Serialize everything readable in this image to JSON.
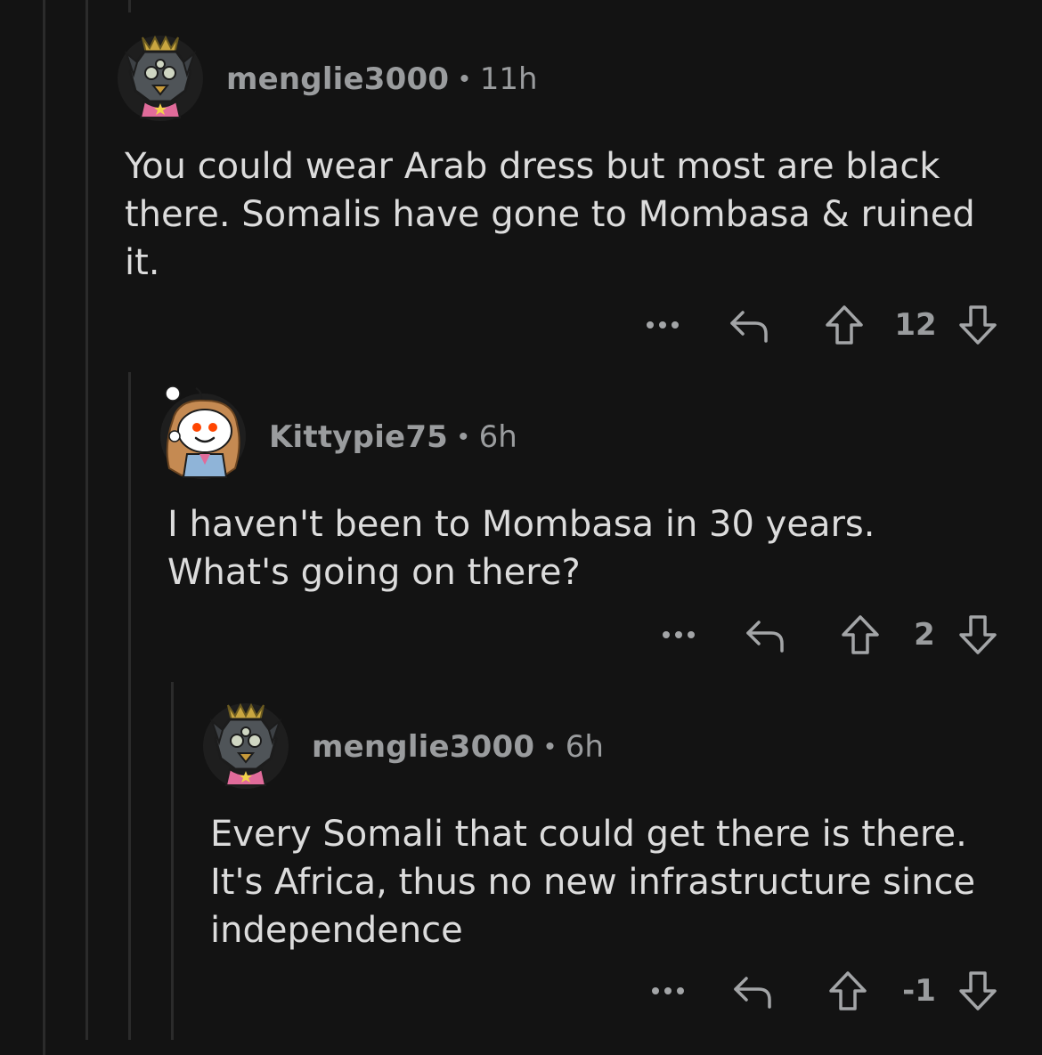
{
  "comments": [
    {
      "username": "menglie3000",
      "separator": "•",
      "time": "11h",
      "body": "You could wear Arab dress but most are black there. Somalis have gone to Mombasa & ruined it.",
      "score": "12",
      "avatar_icon": "snoo-armored-avatar"
    },
    {
      "username": "Kittypie75",
      "separator": "•",
      "time": "6h",
      "body": "I haven't been to Mombasa in 30 years. What's going on there?",
      "score": "2",
      "avatar_icon": "snoo-long-hair-avatar"
    },
    {
      "username": "menglie3000",
      "separator": "•",
      "time": "6h",
      "body": "Every Somali that could get there is there. It's Africa, thus no new infrastructure since independence",
      "score": "-1",
      "avatar_icon": "snoo-armored-avatar"
    }
  ],
  "icons": {
    "more": "more-options-icon",
    "reply": "reply-icon",
    "upvote": "upvote-icon",
    "downvote": "downvote-icon"
  },
  "colors": {
    "background": "#131313",
    "thread_line": "#2b2b2b",
    "meta_text": "#9a9c9e",
    "body_text": "#dcdcdc"
  }
}
